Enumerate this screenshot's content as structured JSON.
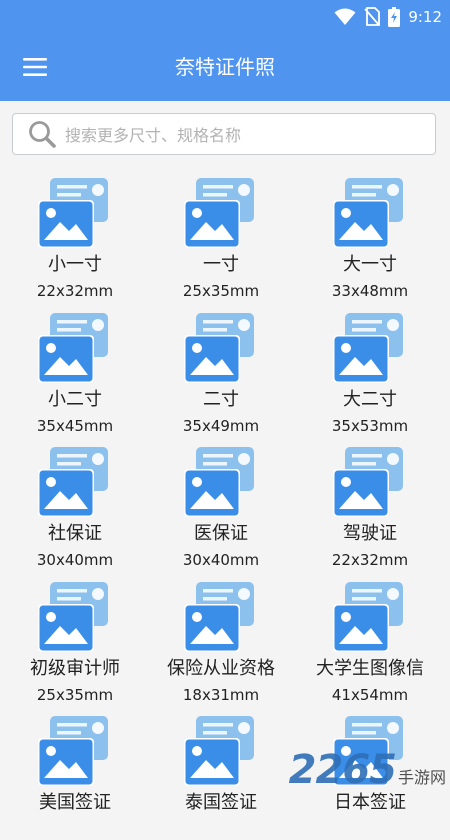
{
  "status_bar": {
    "time": "9:12"
  },
  "app_bar": {
    "title": "奈特证件照"
  },
  "search": {
    "placeholder": "搜索更多尺寸、规格名称"
  },
  "colors": {
    "primary": "#4f94ef",
    "icon_back": "#8cc1ee",
    "icon_front": "#3a8ee8"
  },
  "sizes": [
    {
      "name": "小一寸",
      "size": "22x32mm"
    },
    {
      "name": "一寸",
      "size": "25x35mm"
    },
    {
      "name": "大一寸",
      "size": "33x48mm"
    },
    {
      "name": "小二寸",
      "size": "35x45mm"
    },
    {
      "name": "二寸",
      "size": "35x49mm"
    },
    {
      "name": "大二寸",
      "size": "35x53mm"
    },
    {
      "name": "社保证",
      "size": "30x40mm"
    },
    {
      "name": "医保证",
      "size": "30x40mm"
    },
    {
      "name": "驾驶证",
      "size": "22x32mm"
    },
    {
      "name": "初级审计师",
      "size": "25x35mm"
    },
    {
      "name": "保险从业资格",
      "size": "18x31mm"
    },
    {
      "name": "大学生图像信",
      "size": "41x54mm"
    },
    {
      "name": "美国签证",
      "size": ""
    },
    {
      "name": "泰国签证",
      "size": ""
    },
    {
      "name": "日本签证",
      "size": ""
    }
  ],
  "watermark": {
    "number": "2265",
    "text": "手游网"
  }
}
